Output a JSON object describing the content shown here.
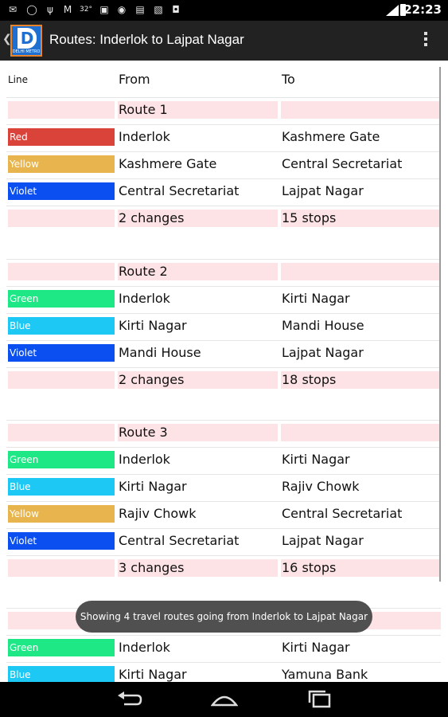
{
  "status_bar": {
    "time": "22:23",
    "left_icons": [
      "mail-icon",
      "whatsapp-icon",
      "usb-icon",
      "gmail-icon",
      "temperature-icon",
      "nine-icon",
      "gps-icon",
      "app-icon",
      "photo-icon",
      "camera-icon"
    ],
    "temperature_text": "32°"
  },
  "action_bar": {
    "title": "Routes: Inderlok to Lajpat Nagar",
    "logo_letter": "D",
    "logo_subtitle": "DELHI METRO"
  },
  "table": {
    "headers": {
      "line": "Line",
      "from": "From",
      "to": "To"
    },
    "routes": [
      {
        "name": "Route 1",
        "segments": [
          {
            "line": "Red",
            "color": "#d9433a",
            "from": "Inderlok",
            "to": "Kashmere Gate"
          },
          {
            "line": "Yellow",
            "color": "#e8b44d",
            "from": "Kashmere Gate",
            "to": "Central Secretariat"
          },
          {
            "line": "Violet",
            "color": "#0b4ff0",
            "from": "Central Secretariat",
            "to": "Lajpat Nagar"
          }
        ],
        "changes": "2 changes",
        "stops": "15 stops"
      },
      {
        "name": "Route 2",
        "segments": [
          {
            "line": "Green",
            "color": "#1ee886",
            "from": "Inderlok",
            "to": "Kirti Nagar"
          },
          {
            "line": "Blue",
            "color": "#1ec8f5",
            "from": "Kirti Nagar",
            "to": "Mandi House"
          },
          {
            "line": "Violet",
            "color": "#0b4ff0",
            "from": "Mandi House",
            "to": "Lajpat Nagar"
          }
        ],
        "changes": "2 changes",
        "stops": "18 stops"
      },
      {
        "name": "Route 3",
        "segments": [
          {
            "line": "Green",
            "color": "#1ee886",
            "from": "Inderlok",
            "to": "Kirti Nagar"
          },
          {
            "line": "Blue",
            "color": "#1ec8f5",
            "from": "Kirti Nagar",
            "to": "Rajiv Chowk"
          },
          {
            "line": "Yellow",
            "color": "#e8b44d",
            "from": "Rajiv Chowk",
            "to": "Central Secretariat"
          },
          {
            "line": "Violet",
            "color": "#0b4ff0",
            "from": "Central Secretariat",
            "to": "Lajpat Nagar"
          }
        ],
        "changes": "3 changes",
        "stops": "16 stops"
      },
      {
        "name": "",
        "segments": [
          {
            "line": "Green",
            "color": "#1ee886",
            "from": "Inderlok",
            "to": "Kirti Nagar"
          },
          {
            "line": "Blue",
            "color": "#1ec8f5",
            "from": "Kirti Nagar",
            "to": "Yamuna Bank"
          }
        ],
        "changes": "",
        "stops": ""
      }
    ]
  },
  "toast": {
    "message": "Showing 4 travel routes going from Inderlok to Lajpat Nagar"
  },
  "nav_bar": {
    "buttons": [
      "back-icon",
      "home-icon",
      "recents-icon"
    ]
  }
}
